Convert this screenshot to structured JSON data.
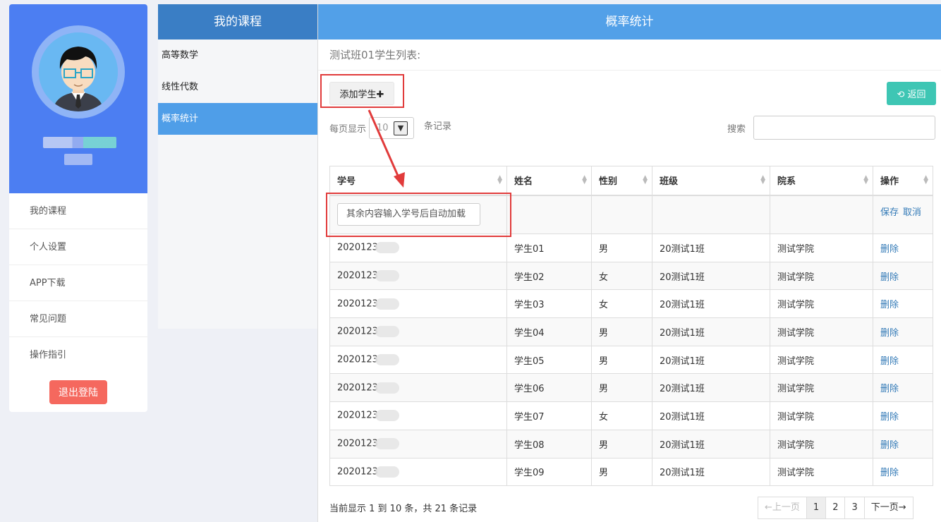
{
  "sidebar": {
    "menu": [
      "我的课程",
      "个人设置",
      "APP下载",
      "常见问题",
      "操作指引"
    ],
    "logout": "退出登陆"
  },
  "courses": {
    "title": "我的课程",
    "items": [
      "高等数学",
      "线性代数",
      "概率统计"
    ],
    "active_index": 2
  },
  "main": {
    "title": "概率统计",
    "subtitle": "测试班01学生列表:",
    "add_button": "添加学生✚",
    "back_button": "返回",
    "per_page_prefix": "每页显示",
    "per_page_value": "10",
    "per_page_suffix": "条记录",
    "search_label": "搜索",
    "search_value": ""
  },
  "table": {
    "headers": [
      "学号",
      "姓名",
      "性别",
      "班级",
      "院系",
      "操作"
    ],
    "edit_row": {
      "input_placeholder": "其余内容输入学号后自动加载",
      "save": "保存",
      "cancel": "取消"
    },
    "delete_label": "删除",
    "rows": [
      [
        "2020123",
        "学生01",
        "男",
        "20测试1班",
        "测试学院"
      ],
      [
        "2020123",
        "学生02",
        "女",
        "20测试1班",
        "测试学院"
      ],
      [
        "2020123",
        "学生03",
        "女",
        "20测试1班",
        "测试学院"
      ],
      [
        "2020123",
        "学生04",
        "男",
        "20测试1班",
        "测试学院"
      ],
      [
        "2020123",
        "学生05",
        "男",
        "20测试1班",
        "测试学院"
      ],
      [
        "2020123",
        "学生06",
        "男",
        "20测试1班",
        "测试学院"
      ],
      [
        "2020123",
        "学生07",
        "女",
        "20测试1班",
        "测试学院"
      ],
      [
        "2020123",
        "学生08",
        "男",
        "20测试1班",
        "测试学院"
      ],
      [
        "2020123",
        "学生09",
        "男",
        "20测试1班",
        "测试学院"
      ]
    ]
  },
  "footer": {
    "info": "当前显示 1 到 10 条，共 21 条记录",
    "prev": "←上一页",
    "pages": [
      "1",
      "2",
      "3"
    ],
    "next": "下一页→",
    "active_page": "1"
  },
  "colors": {
    "profile_bg": "#4c7ef2",
    "header_blue": "#52a0e8",
    "active_course": "#4f9ee8",
    "logout_red": "#f5685e",
    "back_teal": "#3ec6b4",
    "annotation_red": "#e13b3b"
  }
}
